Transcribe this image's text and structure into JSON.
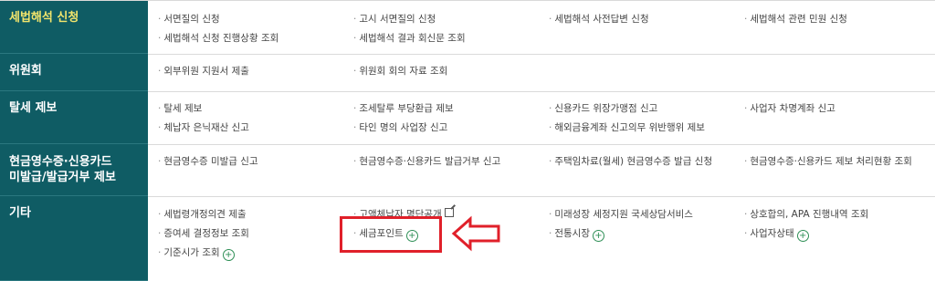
{
  "rows": [
    {
      "category": "세법해석 신청",
      "items": [
        "서면질의 신청",
        "고시 서면질의 신청",
        "세법해석 사전답변 신청",
        "세법해석 관련 민원 신청",
        "세법해석 신청 진행상황 조회",
        "세법해석 결과 회신문 조회"
      ]
    },
    {
      "category": "위원회",
      "items": [
        "외부위원 지원서 제출",
        "위원회 회의 자료 조회"
      ]
    },
    {
      "category": "탈세 제보",
      "items": [
        "탈세 제보",
        "조세탈루 부당환급 제보",
        "신용카드 위장가맹점 신고",
        "사업자 차명계좌 신고",
        "체납자 은닉재산 신고",
        "타인 명의 사업장 신고",
        "해외금융계좌 신고의무 위반행위 제보"
      ]
    },
    {
      "category_line1": "현금영수증·신용카드",
      "category_line2": "미발급/발급거부 제보",
      "items": [
        "현금영수증 미발급 신고",
        "현금영수증·신용카드 발급거부 신고",
        "주택임차료(월세) 현금영수증 발급 신청",
        "현금영수증·신용카드 제보 처리현황 조회"
      ]
    },
    {
      "category": "기타",
      "items": [
        "세법령개정의견 제출",
        "고액체납자 명단공개",
        "미래성장 세정지원 국세상담서비스",
        "상호합의, APA 진행내역 조회",
        "증여세 결정정보 조회",
        "세금포인트",
        "전통시장",
        "사업자상태",
        "기준시가 조회"
      ]
    }
  ],
  "symbols": {
    "plus": "+",
    "dot": "·"
  },
  "colors": {
    "category_bg": "#0f5c64",
    "active_category_text": "#f2e56c",
    "highlight": "#e0202a",
    "plus_icon": "#2e8f56"
  }
}
